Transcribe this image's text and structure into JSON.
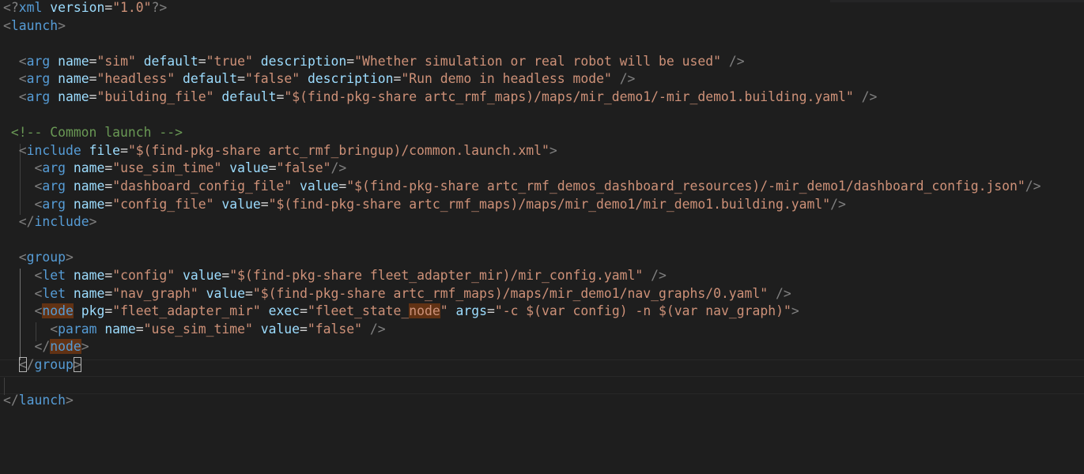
{
  "editor": {
    "lines": {
      "l1": {
        "p1": "<?",
        "tag": "xml",
        "a1": "version",
        "eq": "=",
        "v1": "\"1.0\"",
        "p2": "?>"
      },
      "l2": {
        "p1": "<",
        "tag": "launch",
        "p2": ">"
      },
      "l4": {
        "p1": "<",
        "tag": "arg",
        "a1": "name",
        "eq1": "=",
        "v1": "\"sim\"",
        "a2": "default",
        "eq2": "=",
        "v2": "\"true\"",
        "a3": "description",
        "eq3": "=",
        "v3": "\"Whether simulation or real robot will be used\"",
        "p2": "/>"
      },
      "l5": {
        "p1": "<",
        "tag": "arg",
        "a1": "name",
        "eq1": "=",
        "v1": "\"headless\"",
        "a2": "default",
        "eq2": "=",
        "v2": "\"false\"",
        "a3": "description",
        "eq3": "=",
        "v3": "\"Run demo in headless mode\"",
        "p2": "/>"
      },
      "l6": {
        "p1": "<",
        "tag": "arg",
        "a1": "name",
        "eq1": "=",
        "v1": "\"building_file\"",
        "a2": "default",
        "eq2": "=",
        "v2": "\"$(find-pkg-share artc_rmf_maps)/maps/mir_demo1/-mir_demo1.building.yaml\"",
        "p2": "/>"
      },
      "l8": {
        "comment": "<!-- Common launch -->"
      },
      "l9": {
        "p1": "<",
        "tag": "include",
        "a1": "file",
        "eq1": "=",
        "v1": "\"$(find-pkg-share artc_rmf_bringup)/common.launch.xml\"",
        "p2": ">"
      },
      "l10": {
        "p1": "<",
        "tag": "arg",
        "a1": "name",
        "eq1": "=",
        "v1": "\"use_sim_time\"",
        "a2": "value",
        "eq2": "=",
        "v2": "\"false\"",
        "p2": "/>"
      },
      "l11": {
        "p1": "<",
        "tag": "arg",
        "a1": "name",
        "eq1": "=",
        "v1": "\"dashboard_config_file\"",
        "a2": "value",
        "eq2": "=",
        "v2": "\"$(find-pkg-share artc_rmf_demos_dashboard_resources)/-mir_demo1/dashboard_config.json\"",
        "p2": "/>"
      },
      "l12": {
        "p1": "<",
        "tag": "arg",
        "a1": "name",
        "eq1": "=",
        "v1": "\"config_file\"",
        "a2": "value",
        "eq2": "=",
        "v2": "\"$(find-pkg-share artc_rmf_maps)/maps/mir_demo1/mir_demo1.building.yaml\"",
        "p2": "/>"
      },
      "l13": {
        "p1": "</",
        "tag": "include",
        "p2": ">"
      },
      "l15": {
        "p1": "<",
        "tag": "group",
        "p2": ">"
      },
      "l16": {
        "p1": "<",
        "tag": "let",
        "a1": "name",
        "eq1": "=",
        "v1": "\"config\"",
        "a2": "value",
        "eq2": "=",
        "v2": "\"$(find-pkg-share fleet_adapter_mir)/mir_config.yaml\"",
        "p2": "/>"
      },
      "l17": {
        "p1": "<",
        "tag": "let",
        "a1": "name",
        "eq1": "=",
        "v1": "\"nav_graph\"",
        "a2": "value",
        "eq2": "=",
        "v2": "\"$(find-pkg-share artc_rmf_maps)/maps/mir_demo1/nav_graphs/0.yaml\"",
        "p2": "/>"
      },
      "l18": {
        "p1": "<",
        "tag": "node",
        "a1": "pkg",
        "eq1": "=",
        "v1": "\"fleet_adapter_mir\"",
        "a2": "exec",
        "eq2": "=",
        "v2a": "\"fleet_state_",
        "v2b": "node",
        "v2c": "\"",
        "a3": "args",
        "eq3": "=",
        "v3": "\"-c $(var config) -n $(var nav_graph)\"",
        "p2": ">"
      },
      "l19": {
        "p1": "<",
        "tag": "param",
        "a1": "name",
        "eq1": "=",
        "v1": "\"use_sim_time\"",
        "a2": "value",
        "eq2": "=",
        "v2": "\"false\"",
        "p2": "/>"
      },
      "l20": {
        "p1": "</",
        "tag": "node",
        "p2": ">"
      },
      "l21": {
        "p1": "<",
        "p1b": "/",
        "tag": "group",
        "p2": ">"
      },
      "l23": {
        "p1": "</",
        "tag": "launch",
        "p2": ">"
      }
    }
  }
}
